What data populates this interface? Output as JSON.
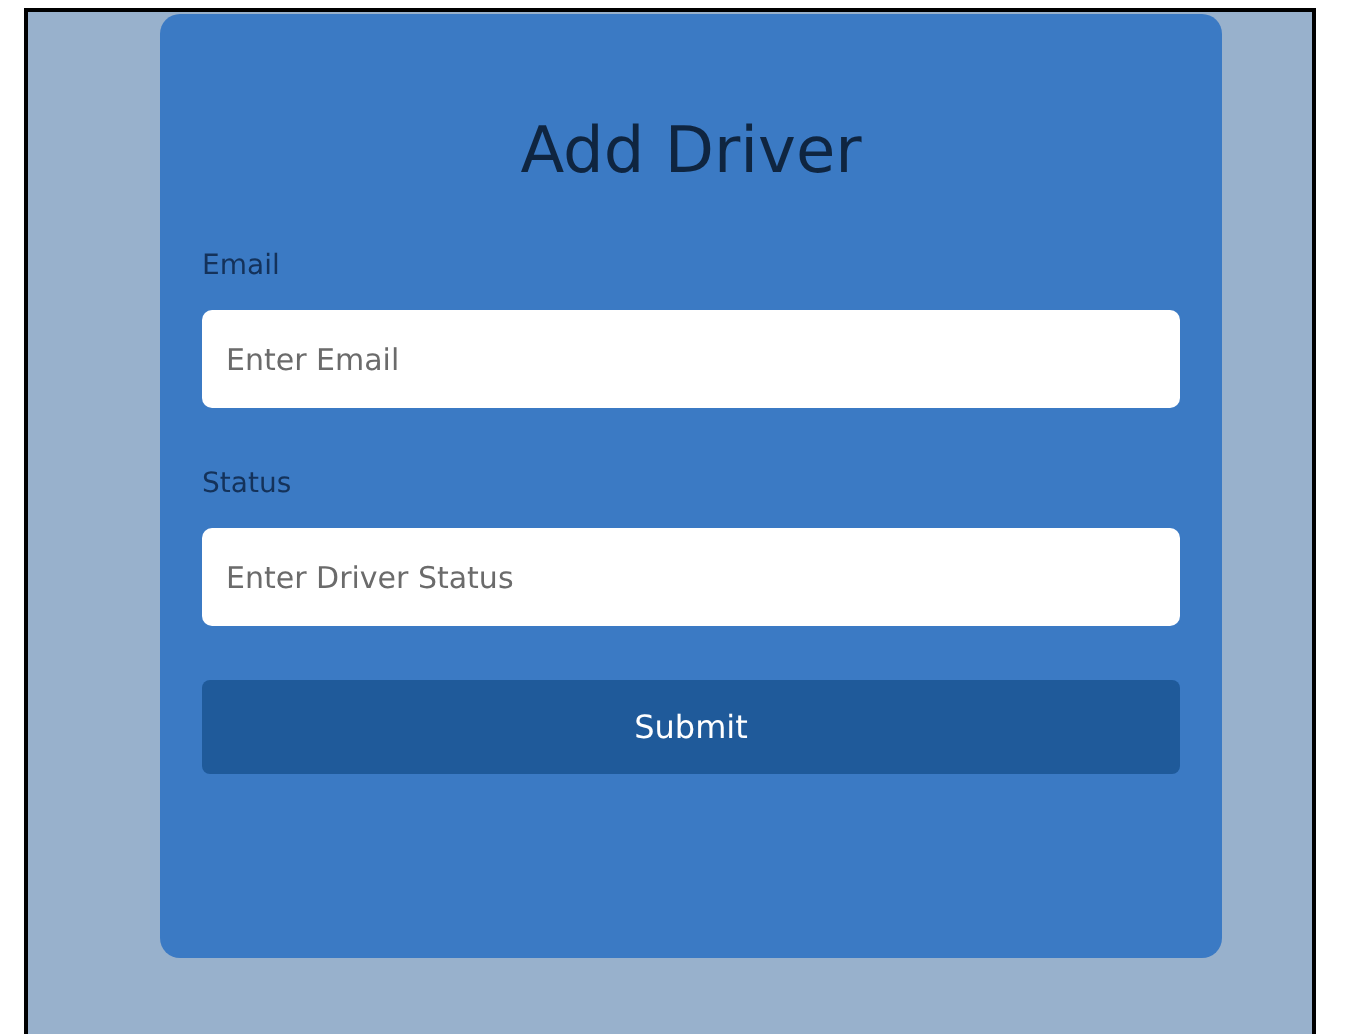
{
  "form": {
    "title": "Add Driver",
    "fields": [
      {
        "label": "Email",
        "placeholder": "Enter Email"
      },
      {
        "label": "Status",
        "placeholder": "Enter Driver Status"
      }
    ],
    "submit": "Submit"
  }
}
